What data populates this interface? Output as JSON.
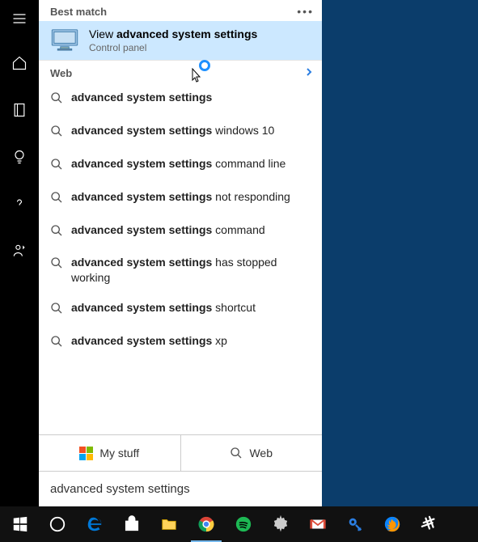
{
  "rail": {
    "items": [
      "menu",
      "home",
      "notebook",
      "bulb",
      "help",
      "person"
    ]
  },
  "header": {
    "best_match": "Best match"
  },
  "best": {
    "pre": "View ",
    "bold": "advanced system settings",
    "sub": "Control panel"
  },
  "web_header": "Web",
  "suggestions": [
    {
      "bold": "advanced system settings",
      "rest": ""
    },
    {
      "bold": "advanced system settings",
      "rest": " windows 10"
    },
    {
      "bold": "advanced system settings",
      "rest": " command line"
    },
    {
      "bold": "advanced system settings",
      "rest": " not responding"
    },
    {
      "bold": "advanced system settings",
      "rest": " command"
    },
    {
      "bold": "advanced system settings",
      "rest": " has stopped working"
    },
    {
      "bold": "advanced system settings",
      "rest": " shortcut"
    },
    {
      "bold": "advanced system settings",
      "rest": " xp"
    }
  ],
  "tabs": {
    "mystuff": "My stuff",
    "web": "Web"
  },
  "search": {
    "value": "advanced system settings"
  },
  "taskbar": {
    "items": [
      "start",
      "cortana",
      "edge",
      "store",
      "file-explorer",
      "chrome",
      "spotify",
      "settings",
      "gmail",
      "keepass",
      "firefox",
      "slack"
    ],
    "active": "chrome"
  }
}
